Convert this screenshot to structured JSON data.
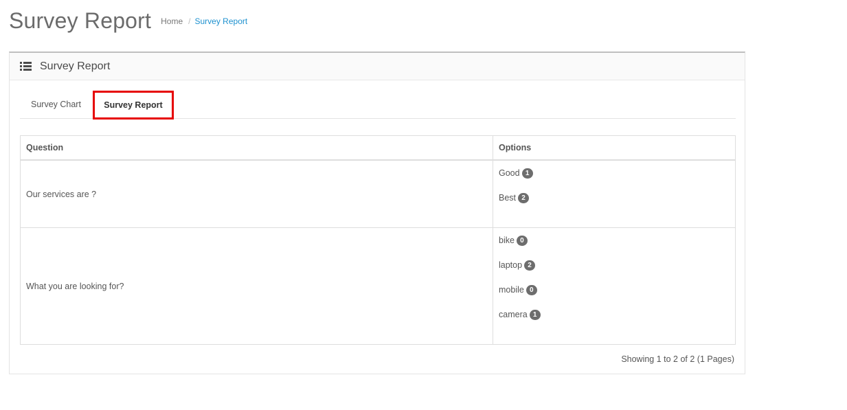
{
  "page": {
    "title": "Survey Report",
    "breadcrumb": {
      "home": "Home",
      "separator": "/",
      "current": "Survey Report"
    }
  },
  "panel": {
    "icon": "list-icon",
    "title": "Survey Report"
  },
  "tabs": [
    {
      "label": "Survey Chart",
      "active": false
    },
    {
      "label": "Survey Report",
      "active": true
    }
  ],
  "table": {
    "headers": {
      "question": "Question",
      "options": "Options"
    },
    "rows": [
      {
        "question": "Our services are ?",
        "options": [
          {
            "label": "Good",
            "count": "1"
          },
          {
            "label": "Best",
            "count": "2"
          }
        ]
      },
      {
        "question": "What you are looking for?",
        "options": [
          {
            "label": "bike",
            "count": "0"
          },
          {
            "label": "laptop",
            "count": "2"
          },
          {
            "label": "mobile",
            "count": "0"
          },
          {
            "label": "camera",
            "count": "1"
          }
        ]
      }
    ]
  },
  "pagination": {
    "text": "Showing 1 to 2 of 2 (1 Pages)"
  },
  "colors": {
    "highlight_border": "#e60000",
    "link": "#1e91cf",
    "badge": "#6d6d6d"
  }
}
